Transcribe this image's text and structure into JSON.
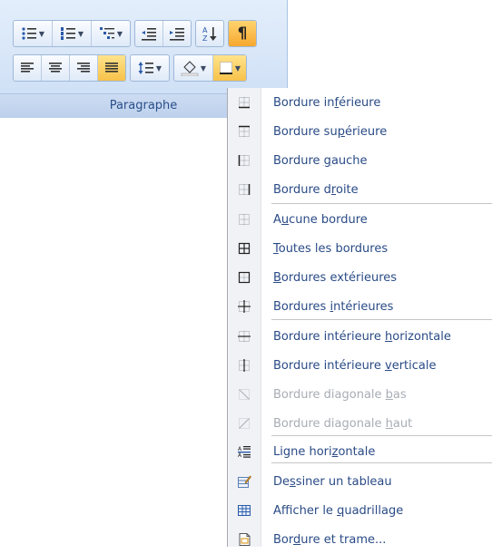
{
  "ribbon": {
    "group_label": "Paragraphe"
  },
  "menu": {
    "items": [
      {
        "label_pre": "Bordure in",
        "accel": "f",
        "label_post": "érieure",
        "icon": "border-bottom-icon",
        "disabled": false
      },
      {
        "label_pre": "Bordure su",
        "accel": "p",
        "label_post": "érieure",
        "icon": "border-top-icon",
        "disabled": false
      },
      {
        "label_pre": "Bordure ",
        "accel": "g",
        "label_post": "auche",
        "icon": "border-left-icon",
        "disabled": false
      },
      {
        "label_pre": "Bordure d",
        "accel": "r",
        "label_post": "oite",
        "icon": "border-right-icon",
        "disabled": false
      },
      {
        "label_pre": "A",
        "accel": "u",
        "label_post": "cune bordure",
        "icon": "no-border-icon",
        "disabled": false
      },
      {
        "label_pre": "",
        "accel": "T",
        "label_post": "outes les bordures",
        "icon": "all-borders-icon",
        "disabled": false
      },
      {
        "label_pre": "",
        "accel": "B",
        "label_post": "ordures extérieures",
        "icon": "outside-borders-icon",
        "disabled": false
      },
      {
        "label_pre": "Bordures ",
        "accel": "i",
        "label_post": "ntérieures",
        "icon": "inside-borders-icon",
        "disabled": false
      },
      {
        "label_pre": "Bordure intérieure ",
        "accel": "h",
        "label_post": "orizontale",
        "icon": "inside-horizontal-border-icon",
        "disabled": false
      },
      {
        "label_pre": "Bordure intérieure ",
        "accel": "v",
        "label_post": "erticale",
        "icon": "inside-vertical-border-icon",
        "disabled": false
      },
      {
        "label_pre": "Bordure diagonale ",
        "accel": "b",
        "label_post": "as",
        "icon": "diagonal-down-border-icon",
        "disabled": true
      },
      {
        "label_pre": "Bordure diagonale ",
        "accel": "h",
        "label_post": "aut",
        "icon": "diagonal-up-border-icon",
        "disabled": true
      },
      {
        "label_pre": "Ligne hori",
        "accel": "z",
        "label_post": "ontale",
        "icon": "horizontal-line-icon",
        "disabled": false
      },
      {
        "label_pre": "De",
        "accel": "s",
        "label_post": "siner un tableau",
        "icon": "draw-table-icon",
        "disabled": false
      },
      {
        "label_pre": "Afficher le ",
        "accel": "q",
        "label_post": "uadrillage",
        "icon": "view-gridlines-icon",
        "disabled": false
      },
      {
        "label_pre": "Bor",
        "accel": "d",
        "label_post": "ure et trame...",
        "icon": "borders-shading-icon",
        "disabled": false
      }
    ]
  },
  "colors": {
    "menu_text": "#2a4b86",
    "disabled_text": "#a8adb5",
    "ribbon_label": "#2a4f8a",
    "highlight": "#f7c24a"
  }
}
